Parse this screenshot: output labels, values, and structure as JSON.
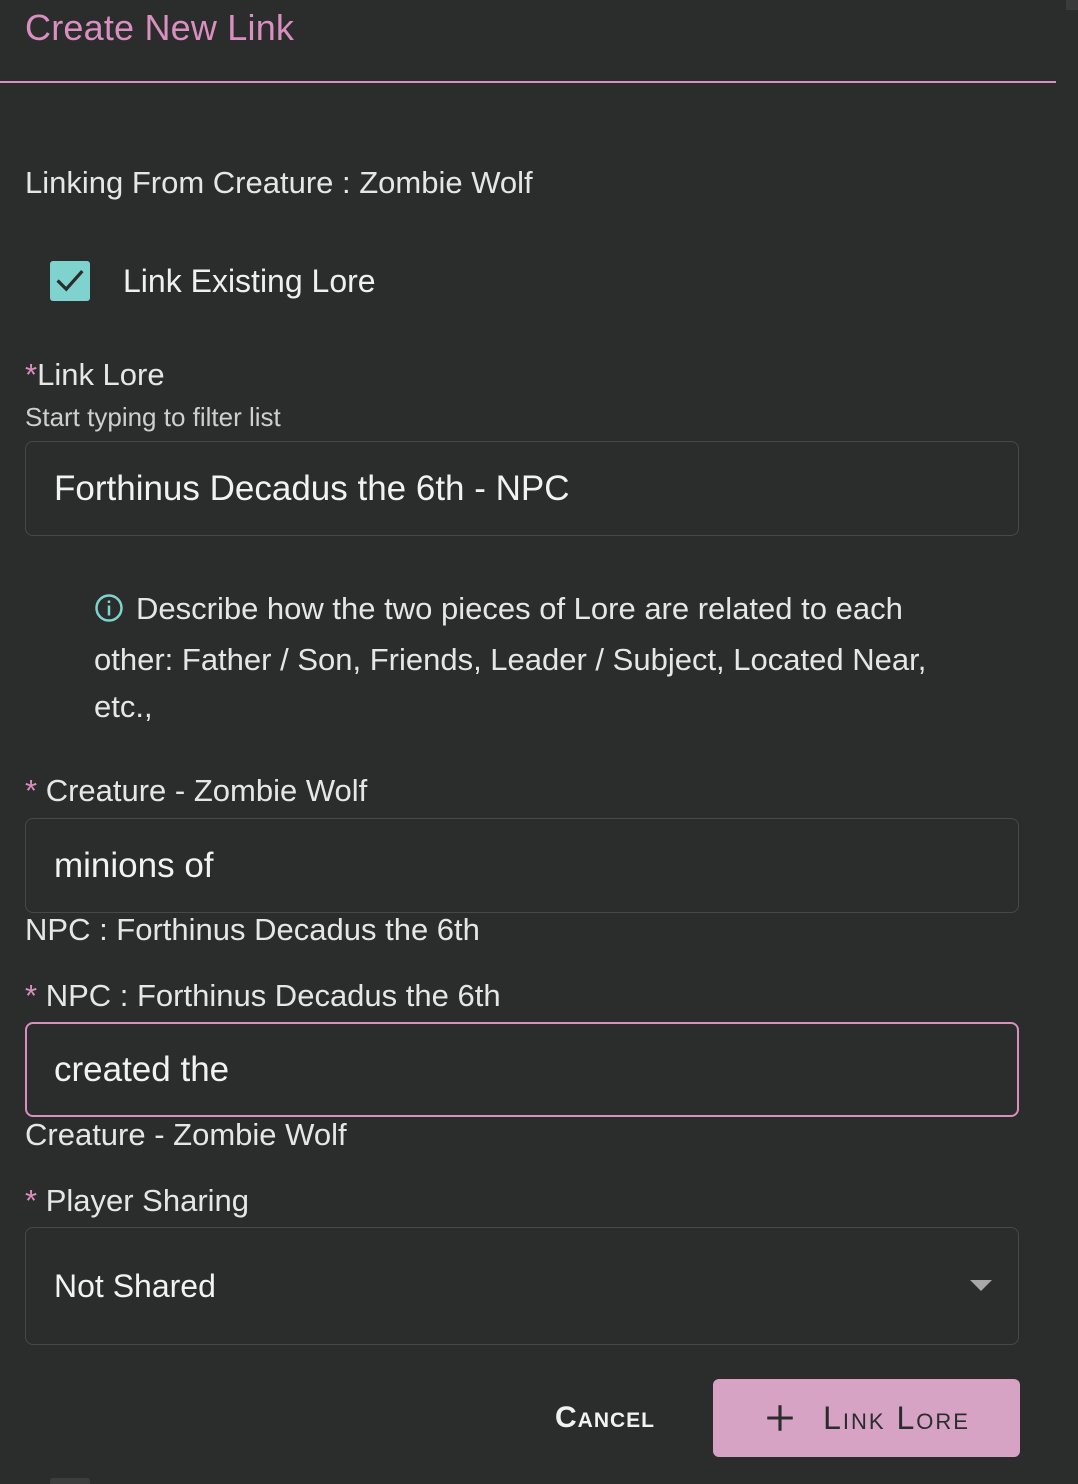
{
  "dialog": {
    "title": "Create New Link"
  },
  "linking_from": "Linking From Creature : Zombie Wolf",
  "link_existing": {
    "label": "Link Existing Lore",
    "checked": true
  },
  "link_lore": {
    "required_mark": "*",
    "label": "Link Lore",
    "helper": "Start typing to filter list",
    "value": "Forthinus Decadus the 6th - NPC"
  },
  "info": {
    "text": "Describe how the two pieces of Lore are related to each other: Father / Son, Friends, Leader / Subject, Located Near, etc.,"
  },
  "creature_field": {
    "required_mark": "* ",
    "label": "Creature - Zombie Wolf",
    "value": "minions of",
    "subtext": "NPC : Forthinus Decadus the 6th"
  },
  "npc_field": {
    "required_mark": "* ",
    "label": "NPC : Forthinus Decadus the 6th",
    "value": "created the",
    "subtext": "Creature - Zombie Wolf"
  },
  "player_sharing": {
    "required_mark": "* ",
    "label": "Player Sharing",
    "selected": "Not Shared"
  },
  "actions": {
    "cancel_label": "Cancel",
    "submit_label": "Link Lore"
  },
  "colors": {
    "accent": "#d98fbf",
    "checkbox": "#7fd3cf",
    "background": "#2b2c2c"
  }
}
